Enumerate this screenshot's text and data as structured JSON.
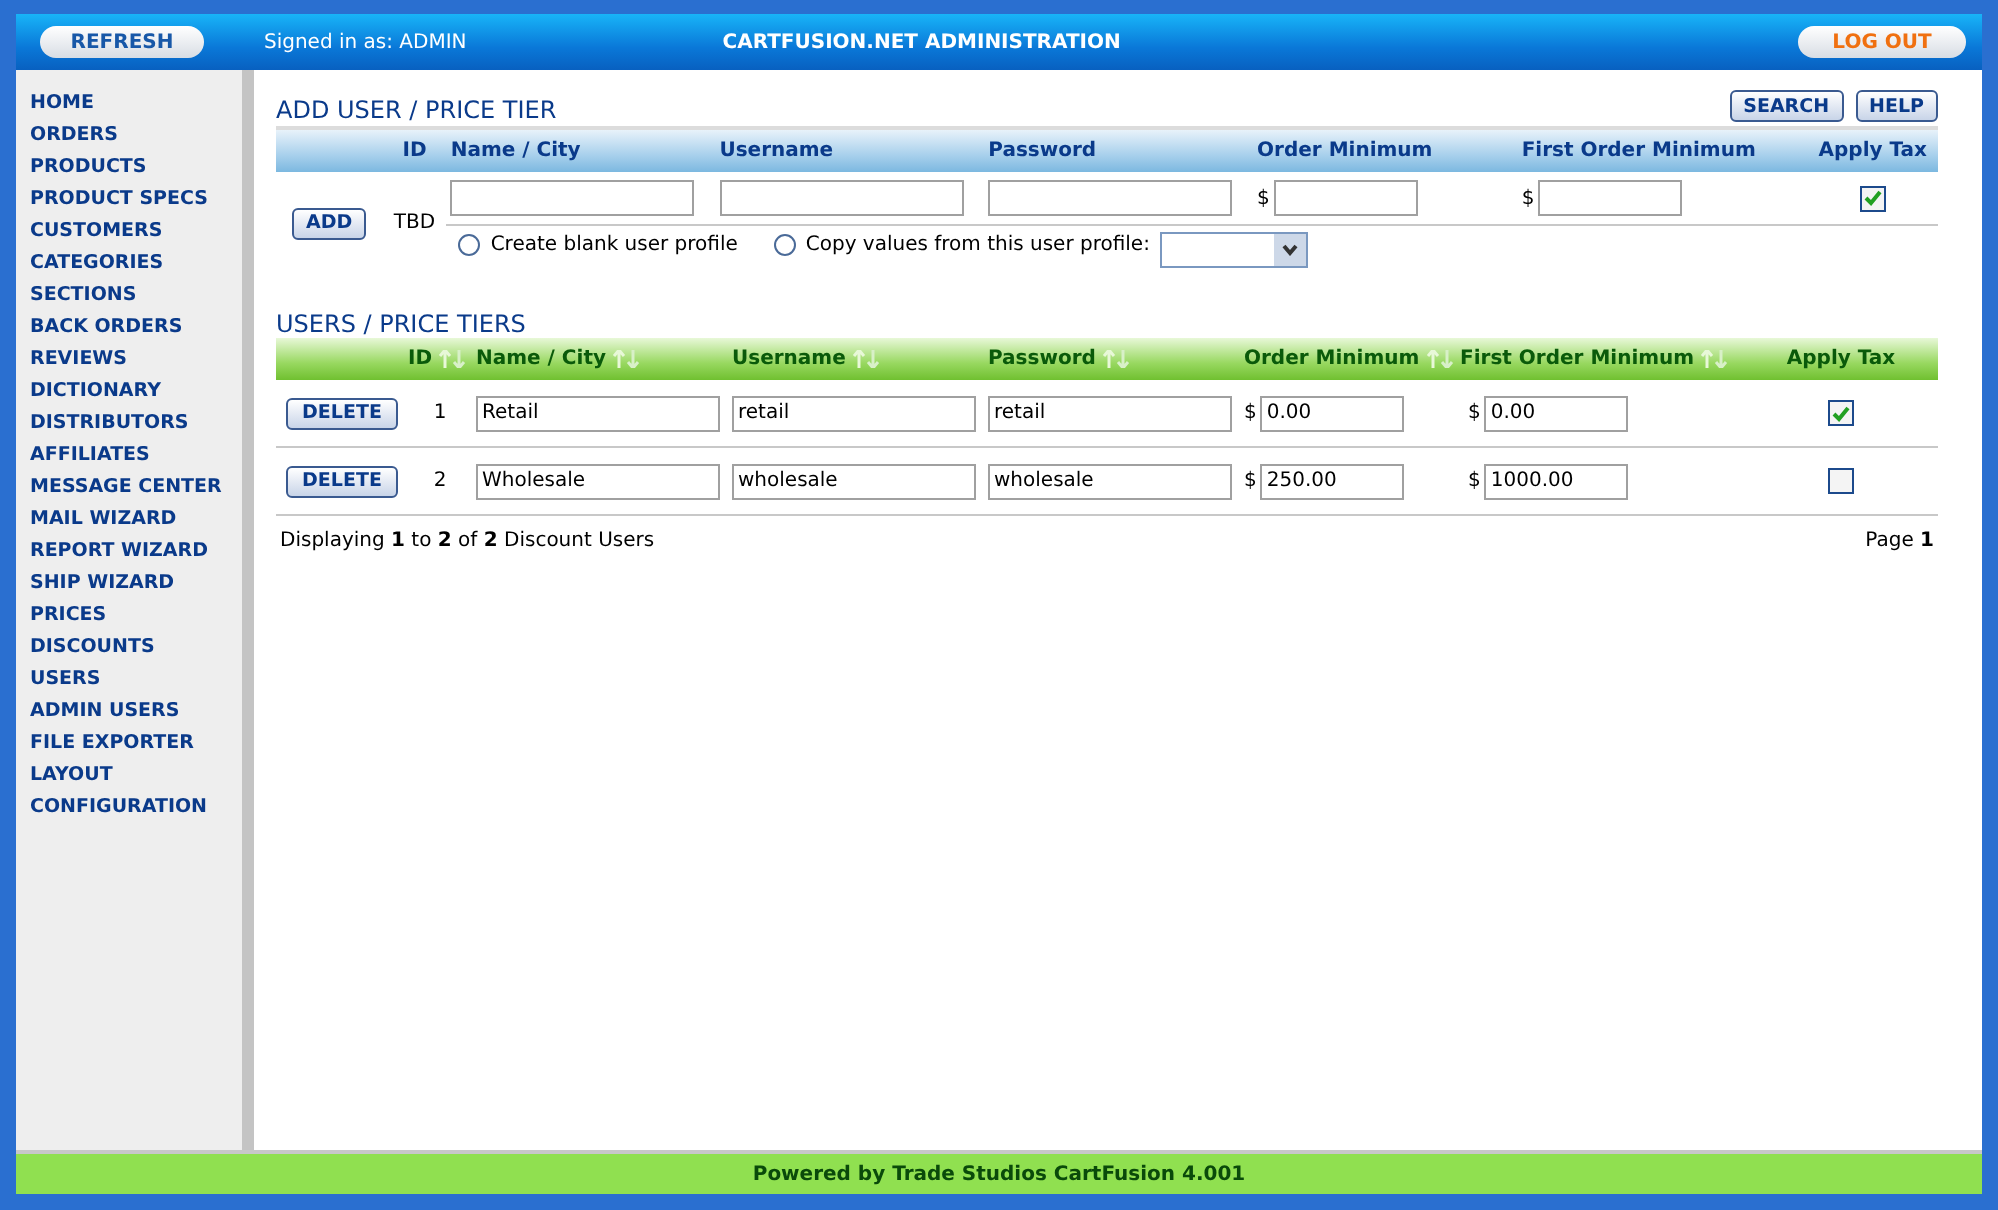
{
  "header": {
    "refresh_button": "REFRESH",
    "signed_in": "Signed in as: ADMIN",
    "title": "CARTFUSION.NET ADMINISTRATION",
    "logout_button": "LOG OUT"
  },
  "sidebar": {
    "items": [
      {
        "label": "HOME"
      },
      {
        "label": "ORDERS"
      },
      {
        "label": "PRODUCTS"
      },
      {
        "label": "PRODUCT SPECS"
      },
      {
        "label": "CUSTOMERS"
      },
      {
        "label": "CATEGORIES"
      },
      {
        "label": "SECTIONS"
      },
      {
        "label": "BACK ORDERS"
      },
      {
        "label": "REVIEWS"
      },
      {
        "label": "DICTIONARY"
      },
      {
        "label": "DISTRIBUTORS"
      },
      {
        "label": "AFFILIATES"
      },
      {
        "label": "MESSAGE CENTER"
      },
      {
        "label": "MAIL WIZARD"
      },
      {
        "label": "REPORT WIZARD"
      },
      {
        "label": "SHIP WIZARD"
      },
      {
        "label": "PRICES"
      },
      {
        "label": "DISCOUNTS"
      },
      {
        "label": "USERS"
      },
      {
        "label": "ADMIN USERS"
      },
      {
        "label": "FILE EXPORTER"
      },
      {
        "label": "LAYOUT"
      },
      {
        "label": "CONFIGURATION"
      }
    ]
  },
  "add_section": {
    "title": "ADD USER / PRICE TIER",
    "buttons": [
      "SEARCH",
      "HELP"
    ],
    "columns": [
      "ID",
      "Name / City",
      "Username",
      "Password",
      "Order Minimum",
      "First Order Minimum",
      "Apply Tax"
    ],
    "row": {
      "add_button": "ADD",
      "id": "TBD",
      "currency": "$",
      "apply_tax": true
    },
    "options": [
      {
        "label": "Create blank user profile",
        "selected": false
      },
      {
        "label": "Copy values from this user profile:",
        "selected": false
      }
    ]
  },
  "users_section": {
    "title": "USERS / PRICE TIERS",
    "columns": [
      {
        "label": "ID",
        "sortable": true
      },
      {
        "label": "Name / City",
        "sortable": true
      },
      {
        "label": "Username",
        "sortable": true
      },
      {
        "label": "Password",
        "sortable": true
      },
      {
        "label": "Order Minimum",
        "sortable": true
      },
      {
        "label": "First Order Minimum",
        "sortable": true
      },
      {
        "label": "Apply Tax",
        "sortable": false
      }
    ],
    "rows": [
      {
        "delete_button": "DELETE",
        "id": "1",
        "name": "Retail",
        "username": "retail",
        "password": "retail",
        "currency": "$",
        "order_minimum": "0.00",
        "first_order_minimum": "0.00",
        "apply_tax": true
      },
      {
        "delete_button": "DELETE",
        "id": "2",
        "name": "Wholesale",
        "username": "wholesale",
        "password": "wholesale",
        "currency": "$",
        "order_minimum": "250.00",
        "first_order_minimum": "1000.00",
        "apply_tax": false
      }
    ],
    "summary": "Displaying **1** to **2** of **2** Discount Users",
    "page": "Page **1**"
  },
  "footer": "Powered by Trade Studios CartFusion 4.001"
}
